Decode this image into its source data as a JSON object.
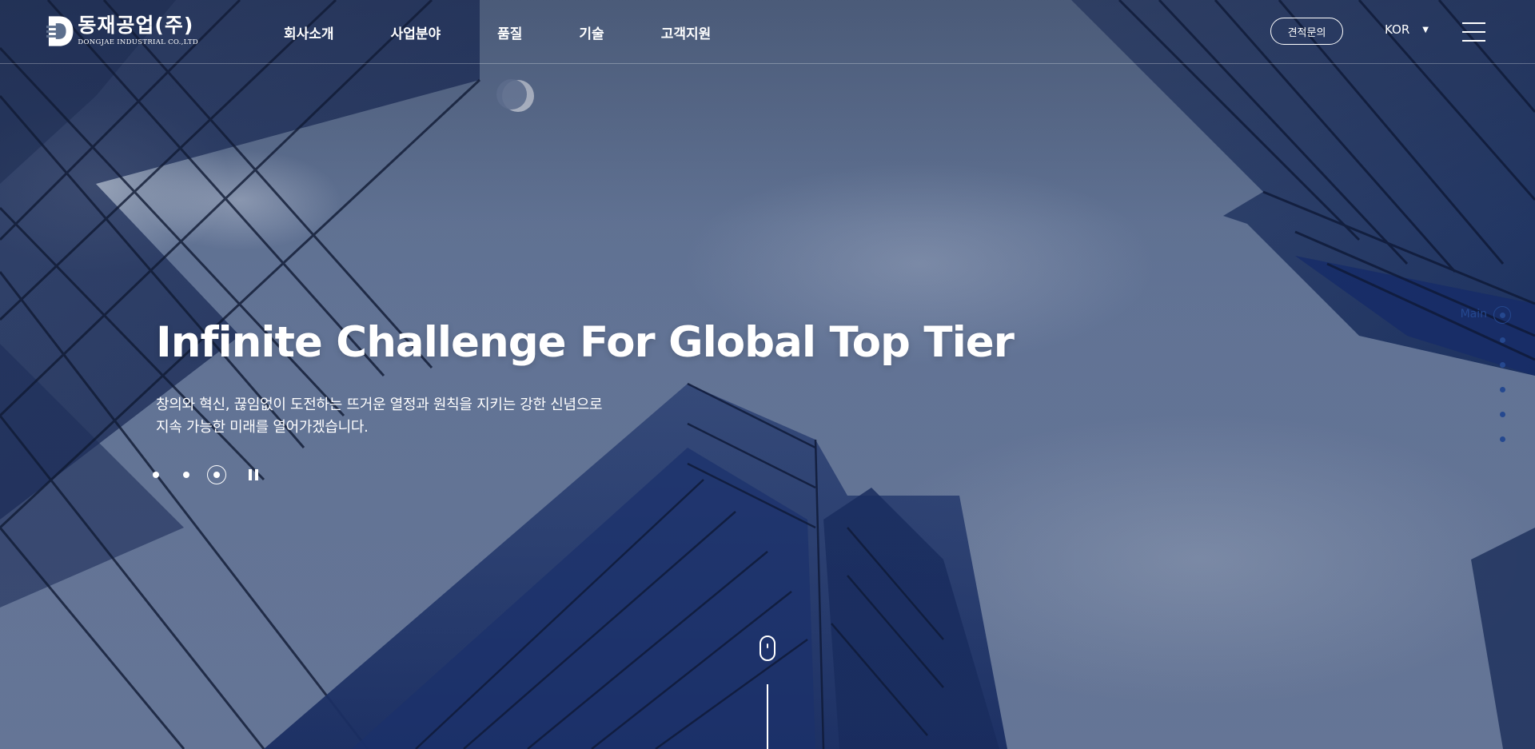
{
  "header": {
    "logo": {
      "name": "동재공업(주)",
      "sub": "DONGJAE INDUSTRIAL CO.,LTD"
    },
    "nav": [
      {
        "label": "회사소개"
      },
      {
        "label": "사업분야"
      },
      {
        "label": "품질"
      },
      {
        "label": "기술"
      },
      {
        "label": "고객지원"
      }
    ],
    "quote_button": "견적문의",
    "language": "KOR"
  },
  "hero": {
    "title": "Infinite Challenge For Global Top Tier",
    "desc_line1": "창의와 혁신, 끊임없이 도전하는 뜨거운 열정과 원칙을 지키는 강한 신념으로",
    "desc_line2": "지속 가능한 미래를 열어가겠습니다.",
    "slides_total": 3,
    "active_slide": 3
  },
  "side_nav": {
    "active_label": "Main",
    "items_count": 6
  },
  "colors": {
    "accent_blue": "#25488f",
    "text": "#ffffff"
  }
}
